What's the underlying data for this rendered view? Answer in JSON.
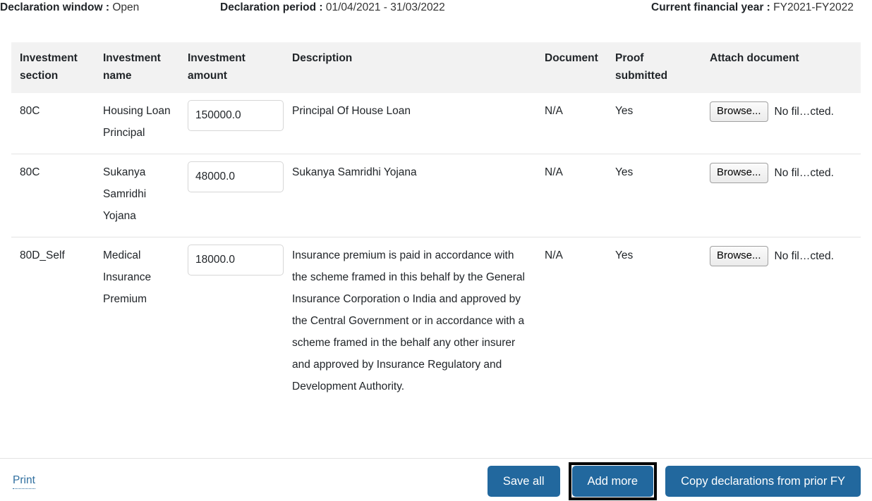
{
  "meta": {
    "declaration_window_label": "Declaration window :",
    "declaration_window_value": "Open",
    "declaration_period_label": "Declaration period :",
    "declaration_period_value": "01/04/2021 - 31/03/2022",
    "current_fy_label": "Current financial year :",
    "current_fy_value": "FY2021-FY2022"
  },
  "table": {
    "columns": [
      "Investment section",
      "Investment name",
      "Investment amount",
      "Description",
      "Document",
      "Proof submitted",
      "Attach document"
    ],
    "rows": [
      {
        "section": "80C",
        "name": "Housing Loan Principal",
        "amount": "150000.0",
        "description": "Principal Of House Loan",
        "document": "N/A",
        "proof_submitted": "Yes",
        "browse_label": "Browse...",
        "file_status": "No fil…cted."
      },
      {
        "section": "80C",
        "name": "Sukanya Samridhi Yojana",
        "amount": "48000.0",
        "description": "Sukanya Samridhi Yojana",
        "document": "N/A",
        "proof_submitted": "Yes",
        "browse_label": "Browse...",
        "file_status": "No fil…cted."
      },
      {
        "section": "80D_Self",
        "name": "Medical Insurance Premium",
        "amount": "18000.0",
        "description": "Insurance premium is paid in accordance with the scheme framed in this behalf by the General Insurance Corporation o India and approved by the Central Government or in accordance with a scheme framed in the behalf any other insurer and approved by Insurance Regulatory and Development Authority.",
        "document": "N/A",
        "proof_submitted": "Yes",
        "browse_label": "Browse...",
        "file_status": "No fil…cted."
      }
    ]
  },
  "footer": {
    "print_label": "Print",
    "save_all_label": "Save all",
    "add_more_label": "Add more",
    "copy_prior_label": "Copy declarations from prior FY"
  },
  "colors": {
    "primary_button": "#22689e",
    "link": "#2f6f9f",
    "header_bg": "#f2f2f2",
    "focus_ring": "#000000"
  }
}
